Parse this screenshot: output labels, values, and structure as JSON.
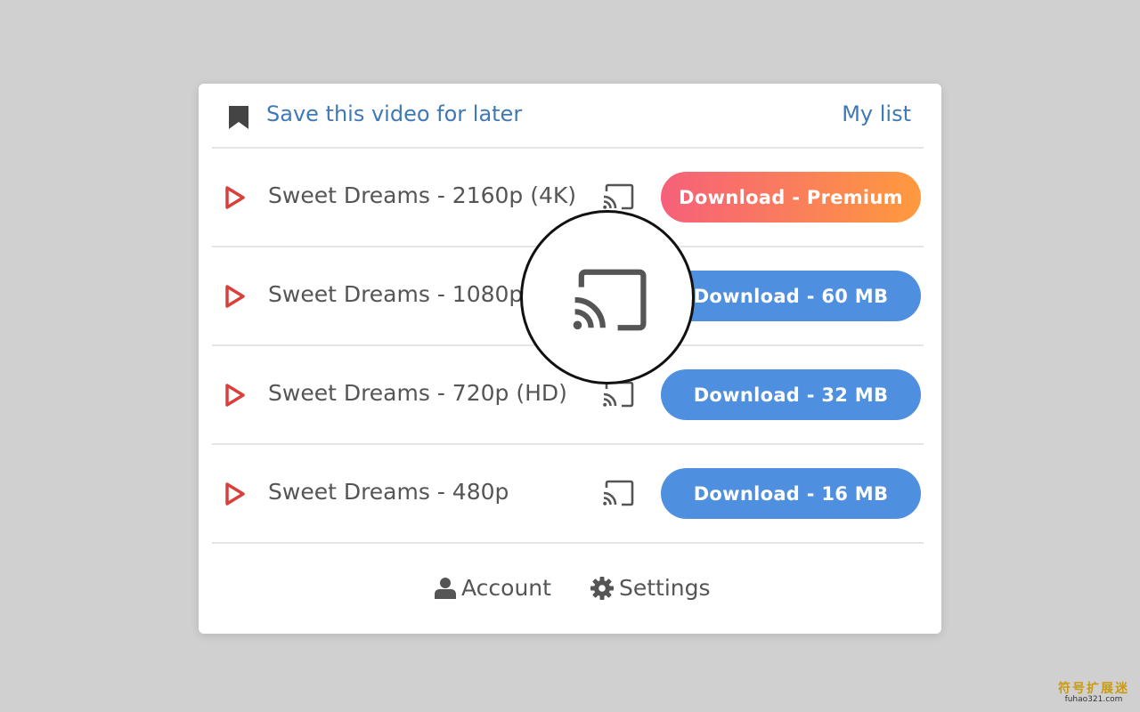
{
  "header": {
    "save_label": "Save this video for later",
    "mylist_label": "My list"
  },
  "rows": [
    {
      "title": "Sweet Dreams - 2160p (4K)",
      "button": "Download - Premium",
      "button_style": "premium"
    },
    {
      "title": "Sweet Dreams - 1080p",
      "button": "Download - 60 MB",
      "button_style": "blue"
    },
    {
      "title": "Sweet Dreams - 720p (HD)",
      "button": "Download - 32 MB",
      "button_style": "blue"
    },
    {
      "title": "Sweet Dreams - 480p",
      "button": "Download - 16 MB",
      "button_style": "blue"
    }
  ],
  "footer": {
    "account_label": "Account",
    "settings_label": "Settings"
  },
  "watermark": {
    "line1": "符号扩展迷",
    "line2": "fuhao321.com"
  },
  "colors": {
    "link": "#3f79b5",
    "button_blue": "#4f8fe0",
    "premium_start": "#f6607a",
    "premium_end": "#fe9a3e",
    "play_icon": "#d9403a"
  },
  "icons": {
    "bookmark": "bookmark-icon",
    "play": "play-icon",
    "cast": "cast-icon",
    "account": "user-icon",
    "settings": "gear-icon"
  }
}
